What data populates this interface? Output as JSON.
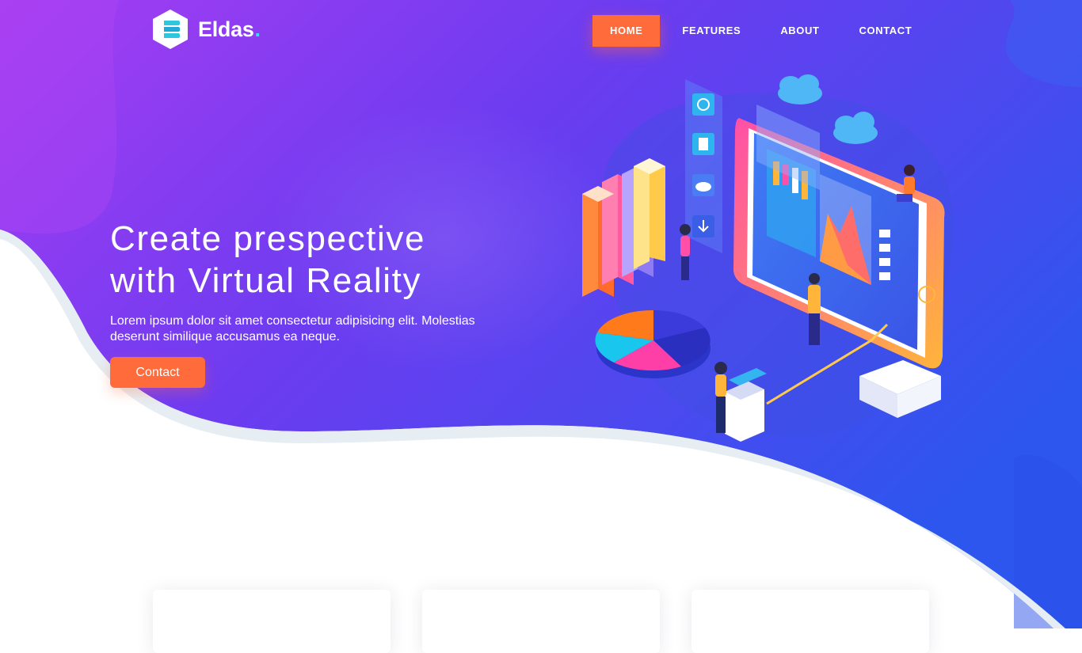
{
  "brand": {
    "name": "Eldas",
    "dot": ".",
    "icon": "stacked-layers-hex-icon"
  },
  "nav": {
    "items": [
      {
        "label": "HOME",
        "active": true
      },
      {
        "label": "FEATURES",
        "active": false
      },
      {
        "label": "ABOUT",
        "active": false
      },
      {
        "label": "CONTACT",
        "active": false
      }
    ]
  },
  "hero": {
    "headline_line1": "Create prespective",
    "headline_line2": "with Virtual Reality",
    "subtext_line1": "Lorem ipsum dolor sit amet consectetur adipisicing elit. Molestias",
    "subtext_line2": "deserunt similique accusamus ea neque.",
    "cta_label": "Contact",
    "illustration": "isometric-virtual-reality-dashboard-illustration"
  },
  "colors": {
    "gradient_start": "#9b3cf0",
    "gradient_mid": "#6a3af0",
    "gradient_end": "#2f5cf0",
    "accent": "#ff6b3a",
    "logo_dot": "#3dd9e8"
  },
  "feature_cards": [
    {},
    {},
    {}
  ]
}
